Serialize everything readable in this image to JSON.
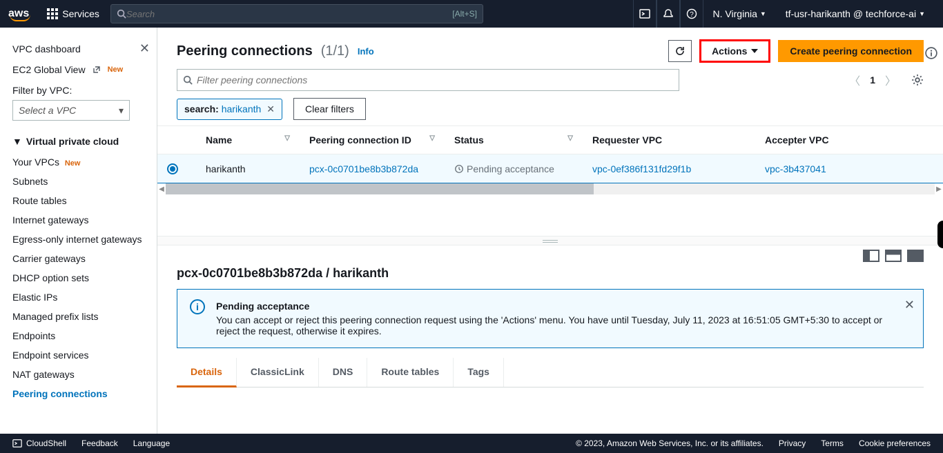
{
  "topnav": {
    "services_label": "Services",
    "search_placeholder": "Search",
    "search_hint": "[Alt+S]",
    "region": "N. Virginia",
    "account": "tf-usr-harikanth @ techforce-ai"
  },
  "sidebar": {
    "dashboard": "VPC dashboard",
    "global_view": "EC2 Global View",
    "new_badge": "New",
    "filter_label": "Filter by VPC:",
    "select_placeholder": "Select a VPC",
    "section": "Virtual private cloud",
    "items": [
      {
        "label": "Your VPCs",
        "new": true
      },
      {
        "label": "Subnets"
      },
      {
        "label": "Route tables"
      },
      {
        "label": "Internet gateways"
      },
      {
        "label": "Egress-only internet gateways"
      },
      {
        "label": "Carrier gateways"
      },
      {
        "label": "DHCP option sets"
      },
      {
        "label": "Elastic IPs"
      },
      {
        "label": "Managed prefix lists"
      },
      {
        "label": "Endpoints"
      },
      {
        "label": "Endpoint services"
      },
      {
        "label": "NAT gateways"
      },
      {
        "label": "Peering connections",
        "active": true
      }
    ]
  },
  "page": {
    "title": "Peering connections",
    "count": "(1/1)",
    "info": "Info",
    "actions_label": "Actions",
    "create_label": "Create peering connection",
    "filter_placeholder": "Filter peering connections",
    "page_number": "1",
    "chip_key": "search:",
    "chip_value": "harikanth",
    "clear_filters": "Clear filters"
  },
  "table": {
    "cols": [
      "Name",
      "Peering connection ID",
      "Status",
      "Requester VPC",
      "Accepter VPC"
    ],
    "row": {
      "name": "harikanth",
      "pcx": "pcx-0c0701be8b3b872da",
      "status": "Pending acceptance",
      "req": "vpc-0ef386f131fd29f1b",
      "acc": "vpc-3b437041"
    }
  },
  "detail": {
    "title": "pcx-0c0701be8b3b872da / harikanth",
    "notice_title": "Pending acceptance",
    "notice_body": "You can accept or reject this peering connection request using the 'Actions' menu. You have until Tuesday, July 11, 2023 at 16:51:05 GMT+5:30 to accept or reject the request, otherwise it expires.",
    "tabs": [
      "Details",
      "ClassicLink",
      "DNS",
      "Route tables",
      "Tags"
    ]
  },
  "footer": {
    "cloudshell": "CloudShell",
    "feedback": "Feedback",
    "language": "Language",
    "copyright": "© 2023, Amazon Web Services, Inc. or its affiliates.",
    "privacy": "Privacy",
    "terms": "Terms",
    "cookies": "Cookie preferences"
  }
}
